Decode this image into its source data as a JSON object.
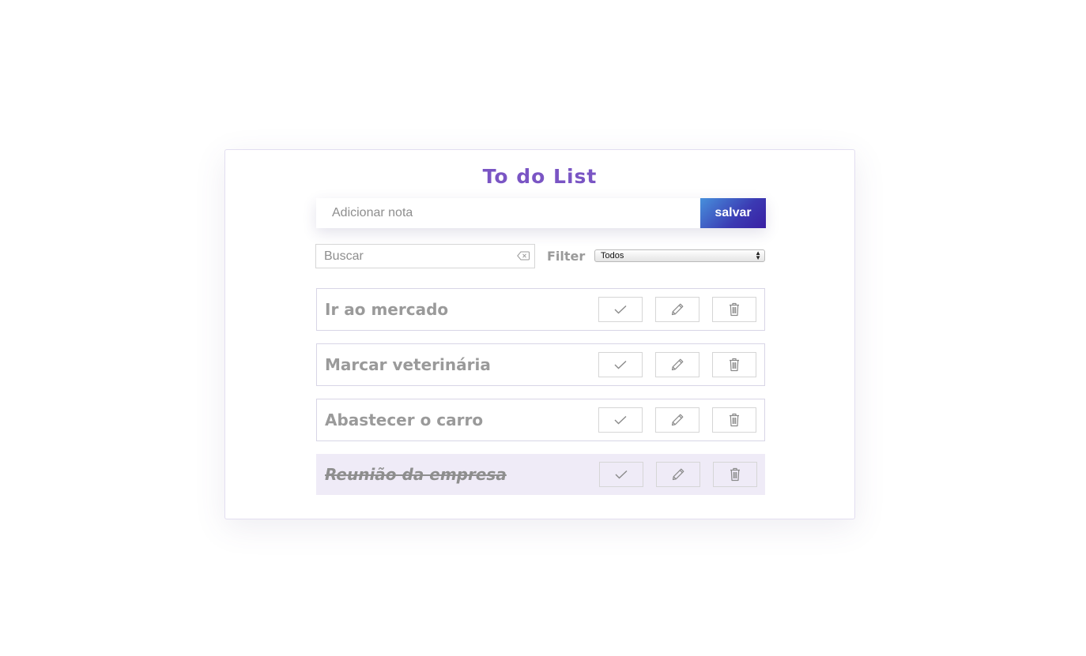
{
  "app": {
    "title": "To do List"
  },
  "add_note": {
    "placeholder": "Adicionar nota",
    "value": "",
    "save_label": "salvar"
  },
  "search": {
    "placeholder": "Buscar",
    "value": ""
  },
  "filter": {
    "label": "Filter",
    "selected": "Todos"
  },
  "todos": [
    {
      "text": "Ir ao mercado",
      "done": false
    },
    {
      "text": "Marcar veterinária",
      "done": false
    },
    {
      "text": "Abastecer o carro",
      "done": false
    },
    {
      "text": "Reunião da empresa",
      "done": true
    }
  ],
  "icons": {
    "complete": "check-icon",
    "edit": "pencil-icon",
    "remove": "trash-icon",
    "clear": "clear-input-icon"
  },
  "colors": {
    "title": "#7a55c4",
    "button_gradient_start": "#4790dc",
    "button_gradient_end": "#3a1fa3",
    "done_row_background": "#efebf7",
    "todo_text": "#9a9a9a"
  }
}
